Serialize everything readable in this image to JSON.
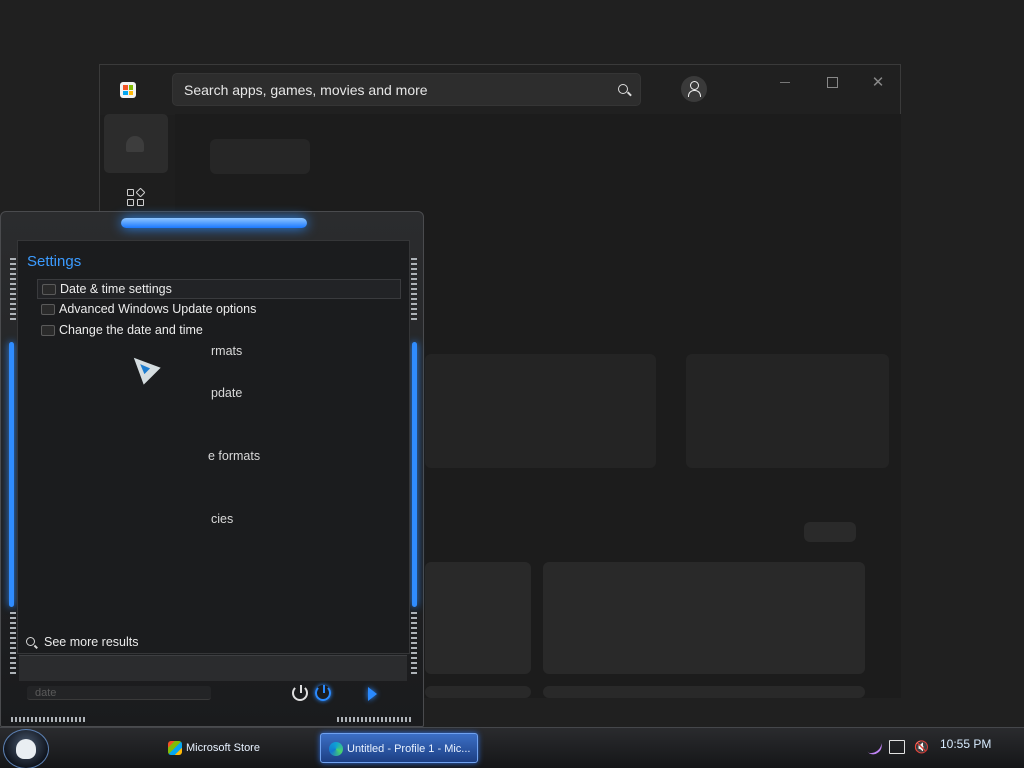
{
  "store": {
    "search_placeholder": "Search apps, games, movies and more",
    "close_glyph": "✕"
  },
  "start_menu": {
    "heading": "Settings",
    "results": [
      {
        "label": "Date & time settings",
        "selected": true
      },
      {
        "label": "Advanced Windows Update options",
        "selected": false
      },
      {
        "label": "Change the date and time",
        "selected": false
      }
    ],
    "obscured_fragments": [
      "rmats",
      "pdate",
      "e formats",
      "cies"
    ],
    "see_more": "See more results",
    "search_value": "date",
    "accent_color": "#2f8cff"
  },
  "taskbar": {
    "buttons": [
      {
        "label": "Microsoft Store",
        "active": false
      },
      {
        "label": "Untitled - Profile 1 - Mic...",
        "active": true
      }
    ],
    "clock": "10:55 PM",
    "volume_glyph": "🔇"
  }
}
